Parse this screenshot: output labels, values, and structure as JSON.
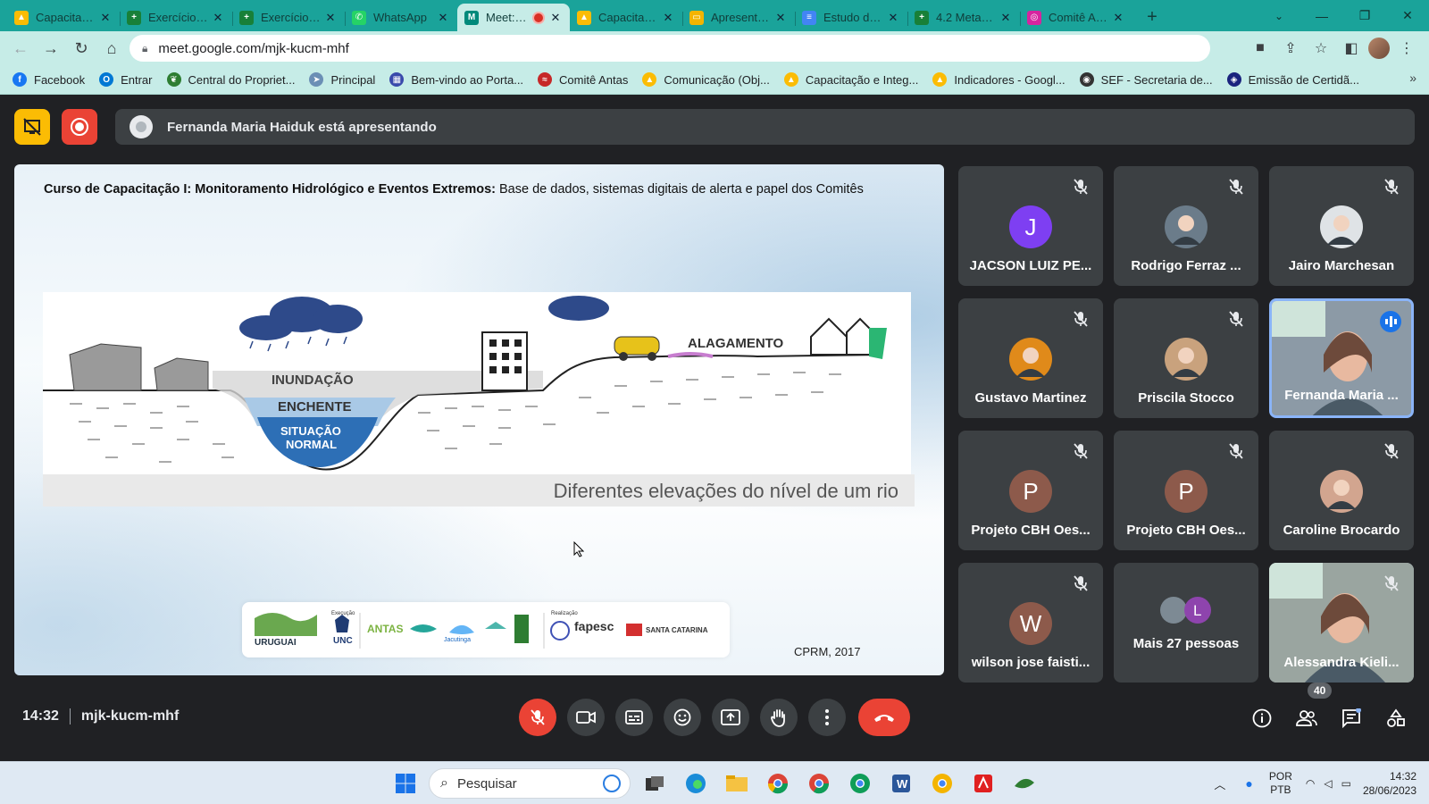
{
  "browser": {
    "tabs": [
      {
        "title": "Capacitação",
        "color": "#fbbc04",
        "glyph": "▲",
        "active": false
      },
      {
        "title": "Exercício para",
        "color": "#188038",
        "glyph": "+",
        "active": false
      },
      {
        "title": "Exercício para",
        "color": "#188038",
        "glyph": "+",
        "active": false
      },
      {
        "title": "WhatsApp",
        "color": "#25d366",
        "glyph": "✆",
        "active": false
      },
      {
        "title": "Meet: mjk-kucm-mhf",
        "color": "#00897b",
        "glyph": "M",
        "active": true
      },
      {
        "title": "Capacitação",
        "color": "#fbbc04",
        "glyph": "▲",
        "active": false
      },
      {
        "title": "Apresentação",
        "color": "#f4b400",
        "glyph": "▭",
        "active": false
      },
      {
        "title": "Estudo de Caso",
        "color": "#4285f4",
        "glyph": "≡",
        "active": false
      },
      {
        "title": "4.2 Metas do",
        "color": "#188038",
        "glyph": "+",
        "active": false
      },
      {
        "title": "Comitê Antas",
        "color": "#d6249f",
        "glyph": "◎",
        "active": false
      }
    ],
    "url": "meet.google.com/mjk-kucm-mhf",
    "bookmarks": [
      {
        "label": "Facebook",
        "color": "#1877f2",
        "glyph": "f"
      },
      {
        "label": "Entrar",
        "color": "#0078d4",
        "glyph": "O"
      },
      {
        "label": "Central do Propriet...",
        "color": "#2e7d32",
        "glyph": "❦"
      },
      {
        "label": "Principal",
        "color": "#6b8fb5",
        "glyph": "➤"
      },
      {
        "label": "Bem-vindo ao Porta...",
        "color": "#3949ab",
        "glyph": "▦"
      },
      {
        "label": "Comitê Antas",
        "color": "#c62828",
        "glyph": "≈"
      },
      {
        "label": "Comunicação (Obj...",
        "color": "#fbbc04",
        "glyph": "▲"
      },
      {
        "label": "Capacitação e Integ...",
        "color": "#fbbc04",
        "glyph": "▲"
      },
      {
        "label": "Indicadores - Googl...",
        "color": "#fbbc04",
        "glyph": "▲"
      },
      {
        "label": "SEF - Secretaria de...",
        "color": "#333333",
        "glyph": "◉"
      },
      {
        "label": "Emissão de Certidã...",
        "color": "#1a237e",
        "glyph": "◈"
      }
    ]
  },
  "meet": {
    "presenter_text": "Fernanda Maria Haiduk está apresentando",
    "slide": {
      "title_bold": "Curso de Capacitação I: Monitoramento Hidrológico e Eventos Extremos:",
      "title_rest": " Base de dados, sistemas digitais de alerta e papel dos Comitês",
      "figure_labels": {
        "inundacao": "INUNDAÇÃO",
        "enchente": "ENCHENTE",
        "situacao1": "SITUAÇÃO",
        "situacao2": "NORMAL",
        "alagamento": "ALAGAMENTO"
      },
      "caption": "Diferentes elevações do nível de um rio",
      "credit": "CPRM, 2017",
      "logos": {
        "uruguai": "URUGUAI",
        "unc": "UNC",
        "antas": "ANTAS",
        "jacutinga": "Jacutinga",
        "fapesc": "fapesc",
        "santa_catarina": "SANTA CATARINA",
        "execucao": "Execução",
        "realizacao": "Realização"
      }
    },
    "participants": [
      {
        "name": "JACSON LUIZ PE...",
        "initial": "J",
        "avatar_color": "#7e3ff2",
        "kind": "initial"
      },
      {
        "name": "Rodrigo Ferraz ...",
        "initial": "",
        "avatar_color": "#6b7c8a",
        "kind": "photo"
      },
      {
        "name": "Jairo Marchesan",
        "initial": "",
        "avatar_color": "#dfe3e6",
        "kind": "photo"
      },
      {
        "name": "Gustavo Martinez",
        "initial": "",
        "avatar_color": "#e08a1a",
        "kind": "photo"
      },
      {
        "name": "Priscila Stocco",
        "initial": "",
        "avatar_color": "#c9a27d",
        "kind": "photo"
      },
      {
        "name": "Fernanda Maria ...",
        "initial": "",
        "avatar_color": "#8c9aa6",
        "kind": "video"
      },
      {
        "name": "Projeto CBH Oes...",
        "initial": "P",
        "avatar_color": "#8d5a4b",
        "kind": "initial"
      },
      {
        "name": "Projeto CBH Oes...",
        "initial": "P",
        "avatar_color": "#8d5a4b",
        "kind": "initial"
      },
      {
        "name": "Caroline Brocardo",
        "initial": "",
        "avatar_color": "#d2a58f",
        "kind": "photo"
      },
      {
        "name": "wilson jose faisti...",
        "initial": "W",
        "avatar_color": "#8d5a4b",
        "kind": "initial"
      },
      {
        "name": "Mais 27 pessoas",
        "initial": "L",
        "avatar_color": "#8e44ad",
        "kind": "more"
      },
      {
        "name": "Alessandra Kieli...",
        "initial": "",
        "avatar_color": "#9aa5a0",
        "kind": "video"
      }
    ],
    "time": "14:32",
    "meeting_code": "mjk-kucm-mhf",
    "people_count": "40"
  },
  "taskbar": {
    "search_placeholder": "Pesquisar",
    "lang_1": "POR",
    "lang_2": "PTB",
    "time": "14:32",
    "date": "28/06/2023"
  }
}
